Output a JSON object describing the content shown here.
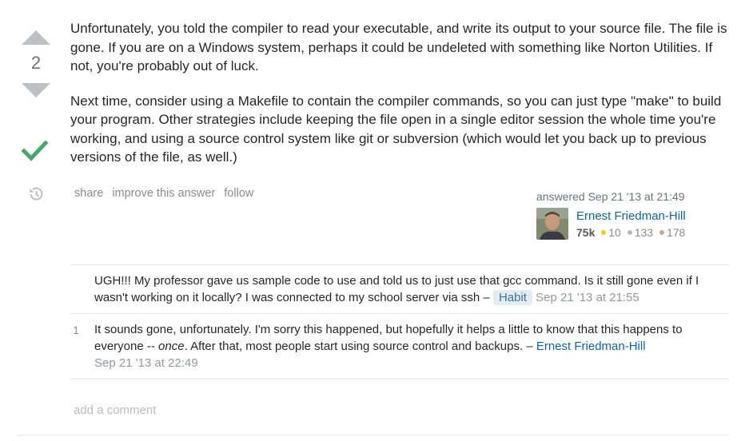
{
  "vote": {
    "count": "2"
  },
  "post": {
    "paragraphs": [
      "Unfortunately, you told the compiler to read your executable, and write its output to your source file. The file is gone. If you are on a Windows system, perhaps it could be undeleted with something like Norton Utilities. If not, you're probably out of luck.",
      "Next time, consider using a Makefile to contain the compiler commands, so you can just type \"make\" to build your program. Other strategies include keeping the file open in a single editor session the whole time you're working, and using a source control system like git or subversion (which would let you back up to previous versions of the file, as well.)"
    ]
  },
  "menu": {
    "share": "share",
    "improve": "improve this answer",
    "follow": "follow"
  },
  "signature": {
    "action_time": "answered Sep 21 '13 at 21:49",
    "user_name": "Ernest Friedman-Hill",
    "reputation": "75k",
    "gold": "10",
    "silver": "133",
    "bronze": "178",
    "colors": {
      "gold": "#ffcc01",
      "silver": "#b4b8bc",
      "bronze": "#d1a684"
    }
  },
  "comments": [
    {
      "score": "",
      "text": "UGH!!! My professor gave us sample code to use and told us to just use that gcc command. Is it still gone even if I wasn't working on it locally? I was connected to my school server via ssh",
      "separator": " – ",
      "user": "Habit",
      "date": "Sep 21 '13 at 21:55"
    },
    {
      "score": "1",
      "text_before": "It sounds gone, unfortunately. I'm sorry this happened, but hopefully it helps a little to know that this happens to everyone -- ",
      "text_em": "once",
      "text_after": ". After that, most people start using source control and backups.",
      "separator": " – ",
      "user": "Ernest Friedman-Hill",
      "date": "Sep 21 '13 at 22:49"
    }
  ],
  "add_comment": "add a comment",
  "icons": {
    "upvote": "arrow-up-icon",
    "downvote": "arrow-down-icon",
    "accepted": "checkmark-icon",
    "history": "history-icon"
  }
}
